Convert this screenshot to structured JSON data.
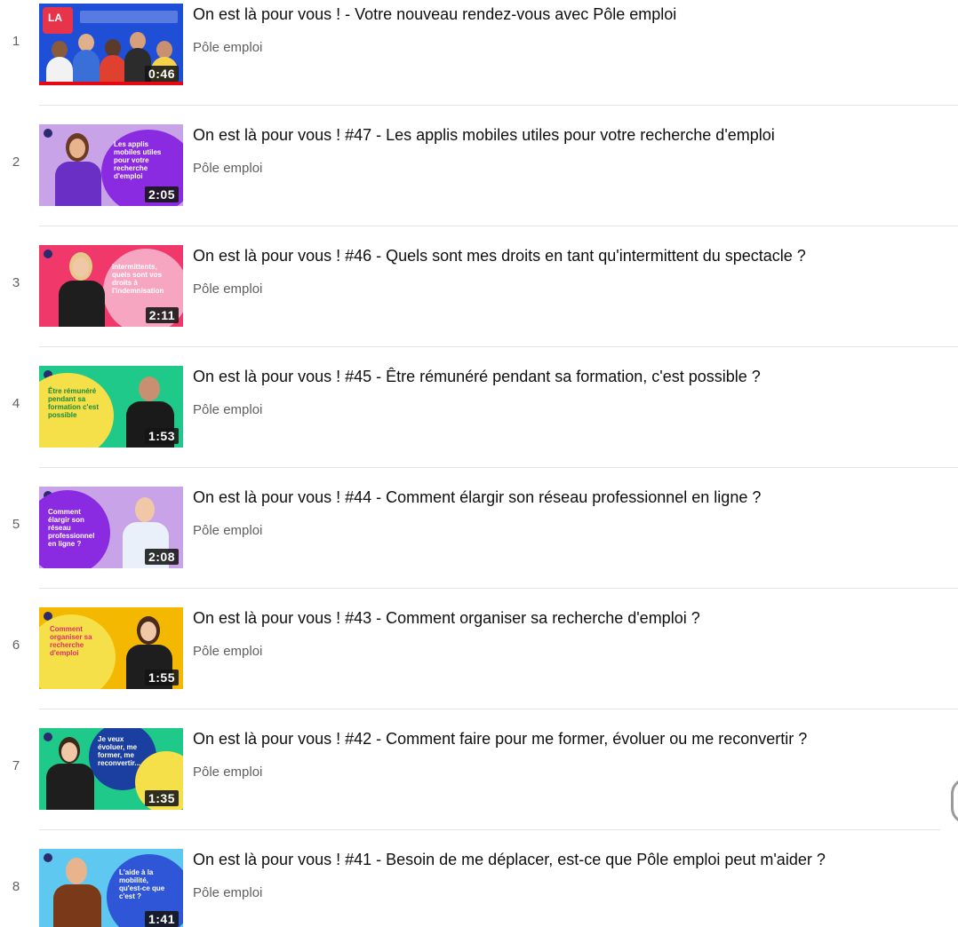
{
  "playlist": {
    "items": [
      {
        "index": "1",
        "title": "On est là pour vous ! - Votre nouveau rendez-vous avec Pôle emploi",
        "channel": "Pôle emploi",
        "duration": "0:46",
        "watched_progress": 1.0,
        "thumb_bg": "#1f4fd6",
        "thumb_accent": "#e8344a",
        "thumb_text": "LA",
        "thumb_icon": "group-photo"
      },
      {
        "index": "2",
        "title": "On est là pour vous ! #47 - Les applis mobiles utiles pour votre recherche d'emploi",
        "channel": "Pôle emploi",
        "duration": "2:05",
        "thumb_bg": "#c9a3e8",
        "thumb_accent": "#8a2be2",
        "thumb_text": "Les applis mobiles utiles pour votre recherche d'emploi",
        "thumb_icon": "presenter-woman"
      },
      {
        "index": "3",
        "title": "On est là pour vous ! #46 - Quels sont mes droits en tant qu'intermittent du spectacle ?",
        "channel": "Pôle emploi",
        "duration": "2:11",
        "thumb_bg": "#f0386b",
        "thumb_accent": "#f7a6c2",
        "thumb_text": "Intermittents, quels sont vos droits à l'indemnisation",
        "thumb_icon": "presenter-woman"
      },
      {
        "index": "4",
        "title": "On est là pour vous ! #45 - Être rémunéré pendant sa formation, c'est possible ?",
        "channel": "Pôle emploi",
        "duration": "1:53",
        "thumb_bg": "#1fc98a",
        "thumb_accent": "#f5e04a",
        "thumb_text": "Être rémunéré pendant sa formation c'est possible",
        "thumb_icon": "presenter-man"
      },
      {
        "index": "5",
        "title": "On est là pour vous ! #44 - Comment élargir son réseau professionnel en ligne ?",
        "channel": "Pôle emploi",
        "duration": "2:08",
        "thumb_bg": "#c9a3e8",
        "thumb_accent": "#8a2be2",
        "thumb_text": "Comment élargir son réseau professionnel en ligne ?",
        "thumb_icon": "presenter-man"
      },
      {
        "index": "6",
        "title": "On est là pour vous ! #43 - Comment organiser sa recherche d'emploi ?",
        "channel": "Pôle emploi",
        "duration": "1:55",
        "thumb_bg": "#f5b800",
        "thumb_accent": "#f5e04a",
        "thumb_text": "Comment organiser sa recherche d'emploi",
        "thumb_icon": "presenter-woman"
      },
      {
        "index": "7",
        "title": "On est là pour vous ! #42 - Comment faire pour me former, évoluer ou me reconvertir ?",
        "channel": "Pôle emploi",
        "duration": "1:35",
        "thumb_bg": "#1fc98a",
        "thumb_accent": "#1b3fa0",
        "thumb_text": "Je veux évoluer, me former, me reconvertir...",
        "thumb_icon": "presenter-woman"
      },
      {
        "index": "8",
        "title": "On est là pour vous ! #41 - Besoin de me déplacer, est-ce que Pôle emploi peut m'aider ?",
        "channel": "Pôle emploi",
        "duration": "1:41",
        "thumb_bg": "#5ec8f0",
        "thumb_accent": "#2f56d6",
        "thumb_text": "L'aide à la mobilité, qu'est-ce que c'est ?",
        "thumb_icon": "presenter-man"
      }
    ]
  }
}
